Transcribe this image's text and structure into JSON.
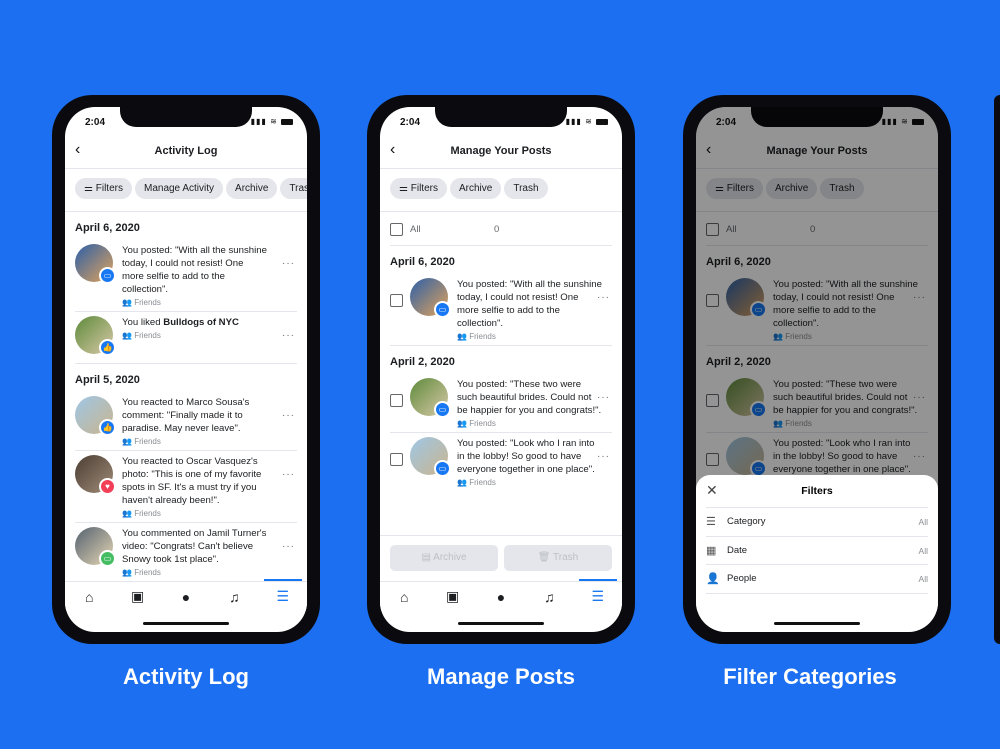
{
  "colors": {
    "background": "#1b6ff0",
    "accent": "#1877f2",
    "like": "#1877f2",
    "love": "#f33e58",
    "comment_video": "#45bd62"
  },
  "status": {
    "time": "2:04"
  },
  "phones": [
    {
      "caption": "Activity Log",
      "title": "Activity Log",
      "chips": [
        "Filters",
        "Manage Activity",
        "Archive",
        "Trash"
      ],
      "sections": [
        {
          "date": "April 6, 2020",
          "items": [
            {
              "text": "You posted: \"With all the sunshine today, I could not resist! One more selfie to add to the collection\".",
              "audience": "Friends",
              "badge": "comment"
            },
            {
              "text": "You liked ",
              "bold": "Bulldogs of NYC",
              "audience": "Friends",
              "badge": "like"
            }
          ]
        },
        {
          "date": "April 5, 2020",
          "items": [
            {
              "text": "You reacted to Marco Sousa's comment: \"Finally made it to paradise. May never leave\".",
              "audience": "Friends",
              "badge": "like"
            },
            {
              "text": "You reacted to Oscar Vasquez's photo: \"This is one of my favorite spots in SF. It's a must try if you haven't already been!\".",
              "audience": "Friends",
              "badge": "love"
            },
            {
              "text": "You commented on Jamil Turner's video: \"Congrats! Can't believe Snowy took 1st place\".",
              "audience": "Friends",
              "badge": "video-comment"
            }
          ]
        }
      ]
    },
    {
      "caption": "Manage Posts",
      "title": "Manage Your Posts",
      "chips": [
        "Filters",
        "Archive",
        "Trash"
      ],
      "select_all": {
        "label": "All",
        "count": "0"
      },
      "sections": [
        {
          "date": "April 6, 2020",
          "items": [
            {
              "text": "You posted: \"With all the sunshine today, I could not resist! One more selfie to add to the collection\".",
              "audience": "Friends",
              "badge": "comment"
            }
          ]
        },
        {
          "date": "April 2, 2020",
          "items": [
            {
              "text": "You posted: \"These two were such beautiful brides. Could not be happier for you and congrats!\".",
              "audience": "Friends",
              "badge": "comment"
            },
            {
              "text": "You posted: \"Look who I ran into in the lobby! So good to have everyone together in one place\".",
              "audience": "Friends",
              "badge": "comment"
            }
          ]
        }
      ],
      "actions": [
        "Archive",
        "Trash"
      ]
    },
    {
      "caption": "Filter Categories",
      "title": "Manage Your Posts",
      "chips": [
        "Filters",
        "Archive",
        "Trash"
      ],
      "select_all": {
        "label": "All",
        "count": "0"
      },
      "sections": [
        {
          "date": "April 6, 2020",
          "items": [
            {
              "text": "You posted: \"With all the sunshine today, I could not resist! One more selfie to add to the collection\".",
              "audience": "Friends",
              "badge": "comment"
            }
          ]
        },
        {
          "date": "April 2, 2020",
          "items": [
            {
              "text": "You posted: \"These two were such beautiful brides. Could not be happier for you and congrats!\".",
              "audience": "Friends",
              "badge": "comment"
            },
            {
              "text": "You posted: \"Look who I ran into in the lobby! So good to have everyone together in one place\".",
              "audience": "Friends",
              "badge": "comment"
            }
          ]
        }
      ],
      "sheet": {
        "title": "Filters",
        "rows": [
          {
            "label": "Category",
            "value": "All",
            "icon": "list-icon"
          },
          {
            "label": "Date",
            "value": "All",
            "icon": "calendar-icon"
          },
          {
            "label": "People",
            "value": "All",
            "icon": "person-icon"
          }
        ]
      }
    }
  ],
  "nav_icons": [
    "home-icon",
    "watch-icon",
    "profile-icon",
    "bell-icon",
    "menu-icon"
  ]
}
